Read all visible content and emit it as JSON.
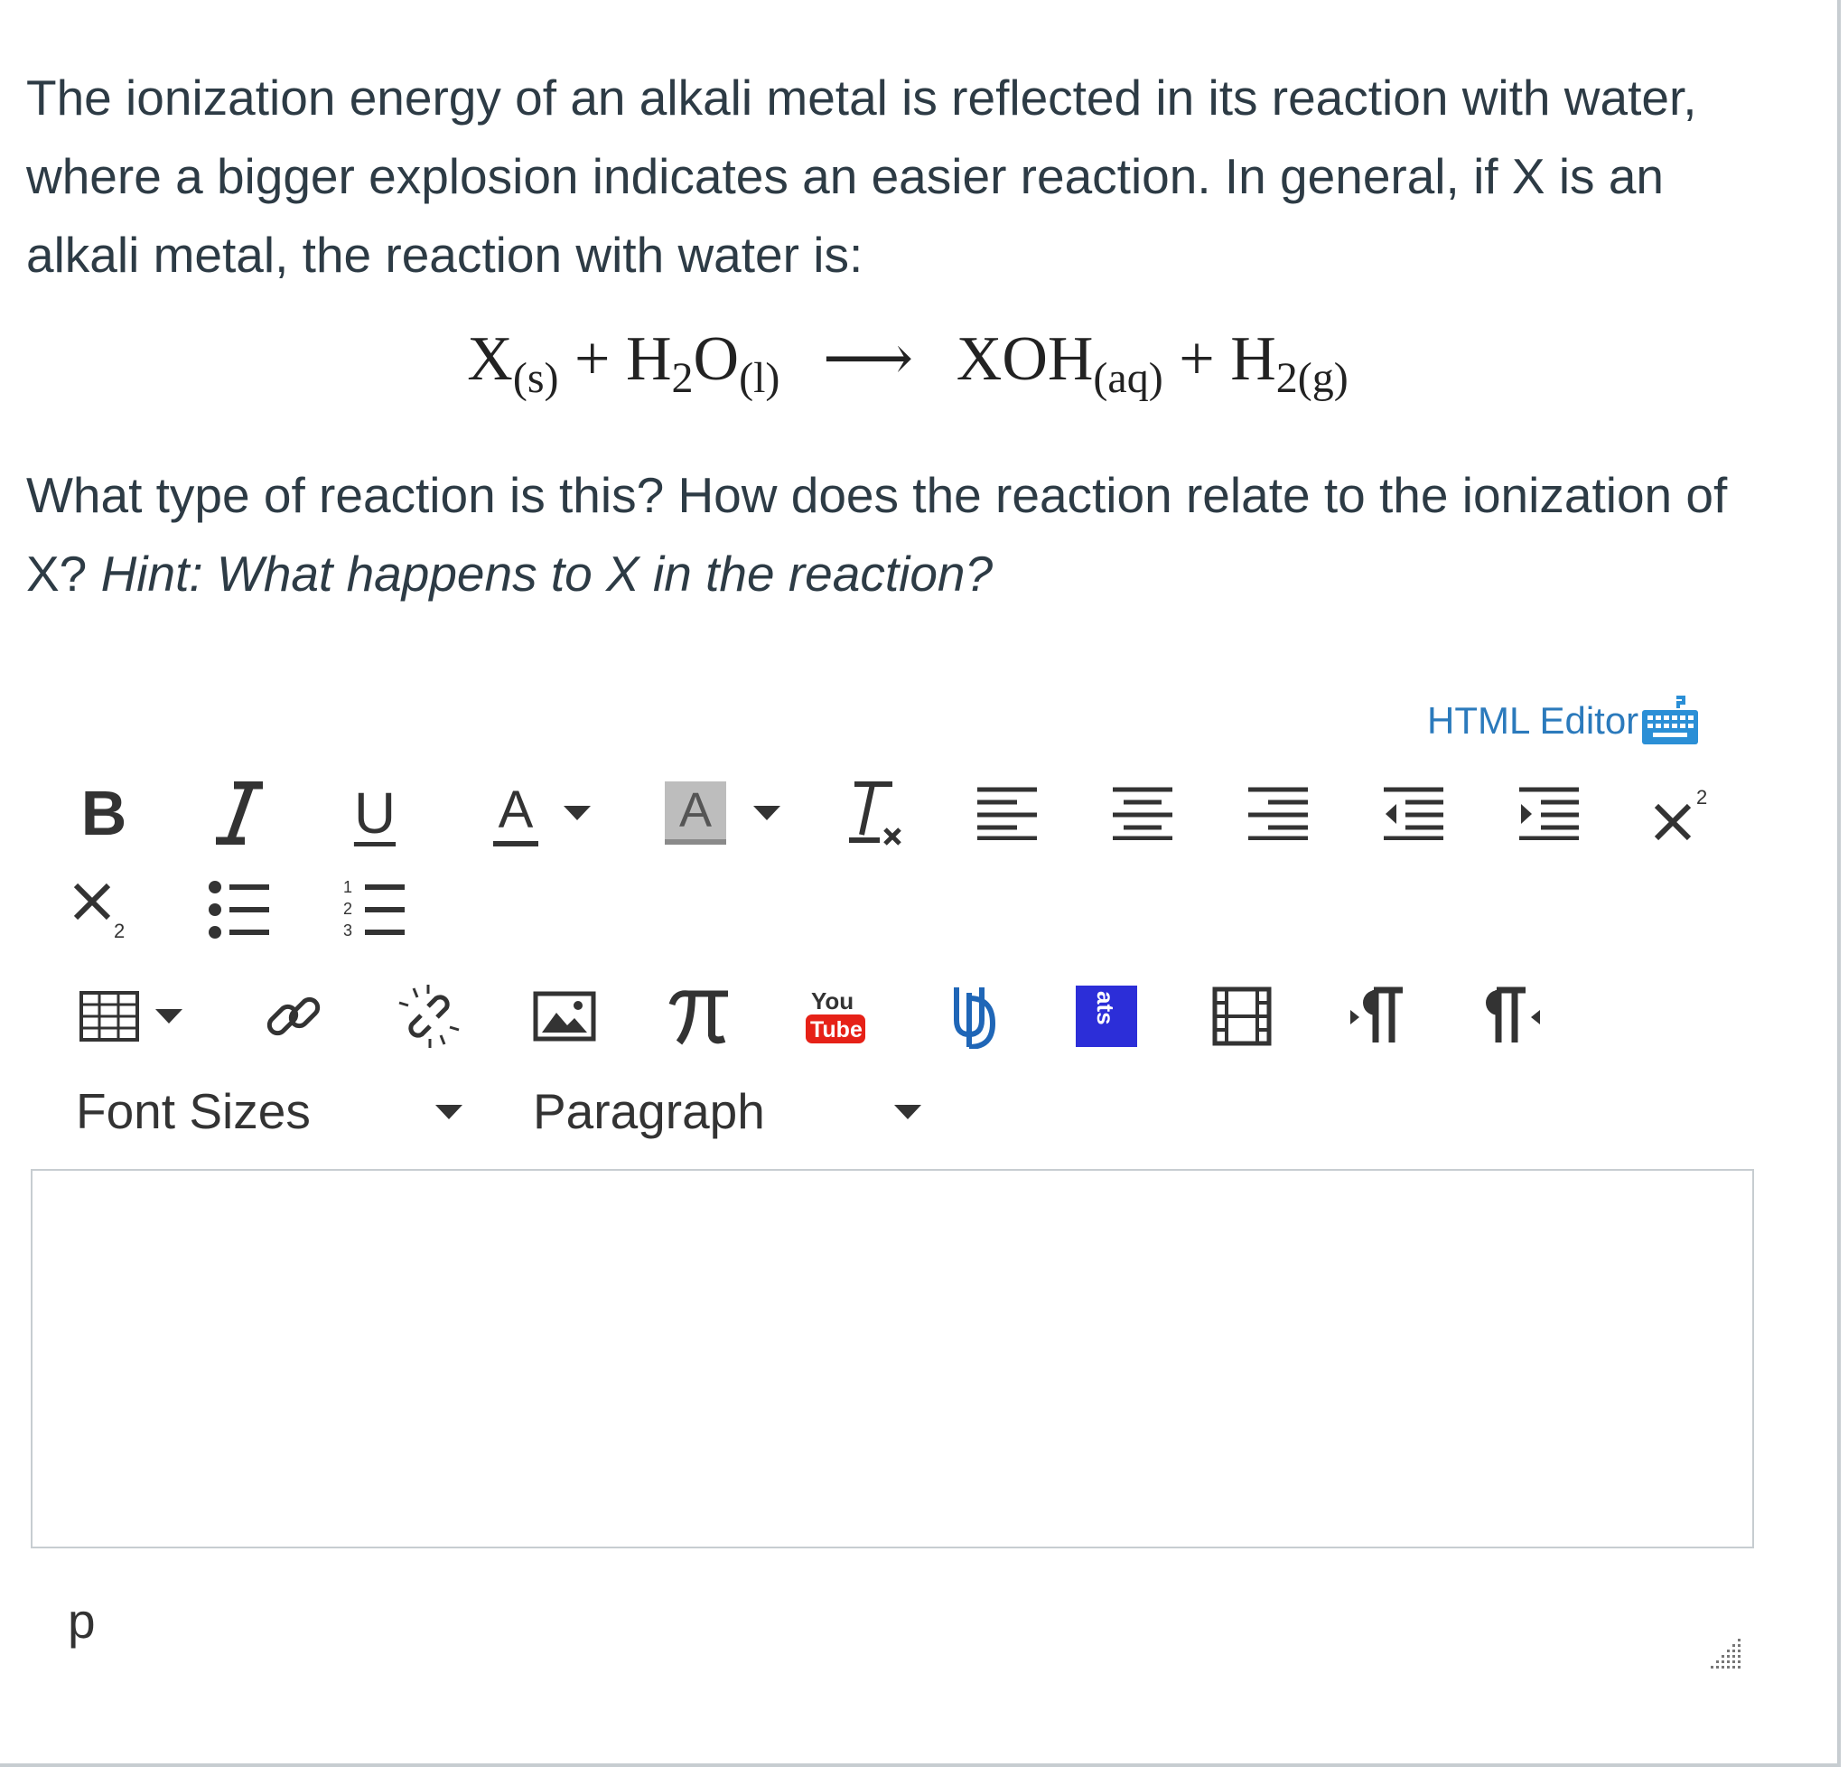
{
  "question": {
    "paragraph1": "The ionization energy of an alkali metal is reflected in its reaction with water, where a bigger explosion indicates an easier reaction. In general, if X is an alkali metal, the reaction with water is:",
    "equation": {
      "X": "X",
      "X_state": "(s)",
      "plus1": "+",
      "H2O_H": "H",
      "H2O_sub": "2",
      "H2O_O": "O",
      "H2O_state": "(l)",
      "arrow": "⟶",
      "XOH": "XOH",
      "XOH_state": "(aq)",
      "plus2": "+",
      "H2_H": "H",
      "H2_state": "2(g)"
    },
    "paragraph2": "What type of reaction is this? How does the reaction relate to the ionization of X?",
    "hint": "Hint: What happens to X in the reaction?"
  },
  "editor": {
    "html_editor_link": "HTML Editor",
    "toolbar": {
      "bold": "B",
      "underline": "U",
      "text_color": "A",
      "bg_color": "A",
      "font_sizes": "Font Sizes",
      "paragraph": "Paragraph"
    },
    "content": "",
    "status_path": "p",
    "icons": [
      "bold-icon",
      "italic-icon",
      "underline-icon",
      "text-color-icon",
      "background-color-icon",
      "clear-formatting-icon",
      "align-left-icon",
      "align-center-icon",
      "align-right-icon",
      "outdent-icon",
      "indent-icon",
      "superscript-icon",
      "subscript-icon",
      "bullet-list-icon",
      "numbered-list-icon",
      "table-icon",
      "link-icon",
      "unlink-icon",
      "image-icon",
      "math-pi-icon",
      "youtube-icon",
      "ud-logo-icon",
      "ats-icon",
      "media-film-icon",
      "ltr-paragraph-icon",
      "rtl-paragraph-icon",
      "keyboard-icon",
      "resize-handle-icon"
    ],
    "colors": {
      "link": "#2b7abc",
      "icon": "#333333",
      "youtube": "#e62117",
      "ud_blue": "#1f66b7",
      "ats_blue": "#2c2ed8"
    }
  }
}
